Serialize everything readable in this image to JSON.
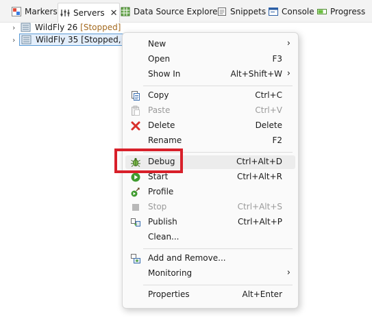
{
  "tabs": [
    {
      "label": "Markers",
      "icon": "markers-icon"
    },
    {
      "label": "Servers",
      "icon": "servers-icon",
      "active": true
    },
    {
      "label": "Data Source Explorer",
      "icon": "data-source-icon"
    },
    {
      "label": "Snippets",
      "icon": "snippets-icon"
    },
    {
      "label": "Console",
      "icon": "console-icon"
    },
    {
      "label": "Progress",
      "icon": "progress-icon"
    }
  ],
  "tree": [
    {
      "name": "WildFly 26",
      "state": "[Stopped]"
    },
    {
      "name": "WildFly 35",
      "state": "[Stopped, Sy"
    }
  ],
  "menu": {
    "new": {
      "label": "New"
    },
    "open": {
      "label": "Open",
      "shortcut": "F3"
    },
    "show_in": {
      "label": "Show In",
      "shortcut": "Alt+Shift+W"
    },
    "copy": {
      "label": "Copy",
      "shortcut": "Ctrl+C"
    },
    "paste": {
      "label": "Paste",
      "shortcut": "Ctrl+V"
    },
    "delete": {
      "label": "Delete",
      "shortcut": "Delete"
    },
    "rename": {
      "label": "Rename",
      "shortcut": "F2"
    },
    "debug": {
      "label": "Debug",
      "shortcut": "Ctrl+Alt+D"
    },
    "start": {
      "label": "Start",
      "shortcut": "Ctrl+Alt+R"
    },
    "profile": {
      "label": "Profile"
    },
    "stop": {
      "label": "Stop",
      "shortcut": "Ctrl+Alt+S"
    },
    "publish": {
      "label": "Publish",
      "shortcut": "Ctrl+Alt+P"
    },
    "clean": {
      "label": "Clean..."
    },
    "add_remove": {
      "label": "Add and Remove..."
    },
    "monitoring": {
      "label": "Monitoring"
    },
    "properties": {
      "label": "Properties",
      "shortcut": "Alt+Enter"
    }
  },
  "colors": {
    "highlight": "#d8202a",
    "state_text": "#a46a1f",
    "selection": "#e3eefb"
  }
}
